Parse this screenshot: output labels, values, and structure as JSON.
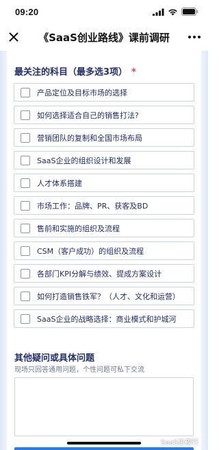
{
  "status_bar": {
    "time": "09:20"
  },
  "nav": {
    "title": "《SaaS创业路线》课前调研",
    "close_icon": "close-icon",
    "more_icon": "more-dots-icon"
  },
  "question1": {
    "title": "最关注的科目（最多选3项）",
    "required_mark": "*",
    "options": [
      {
        "label": "产品定位及目标市场的选择"
      },
      {
        "label": "如何选择适合自己的销售打法?"
      },
      {
        "label": "营销团队的复制和全国市场布局"
      },
      {
        "label": "SaaS企业的组织设计和发展"
      },
      {
        "label": "人才体系搭建"
      },
      {
        "label": "市场工作：品牌、PR、获客及BD"
      },
      {
        "label": "售前和实施的组织及流程"
      },
      {
        "label": "CSM（客户成功）的组织及流程"
      },
      {
        "label": "各部门KPI分解与绩效、提成方案设计"
      },
      {
        "label": "如何打造销售铁军？（人才、文化和运营）"
      },
      {
        "label": "SaaS企业的战略选择：商业模式和护城河"
      }
    ]
  },
  "question2": {
    "title": "其他疑问或具体问题",
    "hint": "现场只回答通用问题，个性问题可私下交流",
    "value": "",
    "placeholder": ""
  },
  "watermark": {
    "text": "SaaS白夜行"
  },
  "colors": {
    "accent": "#2b7be0",
    "required": "#e8403a",
    "text": "#1f2d6b",
    "page_side": "#dce8f8"
  }
}
